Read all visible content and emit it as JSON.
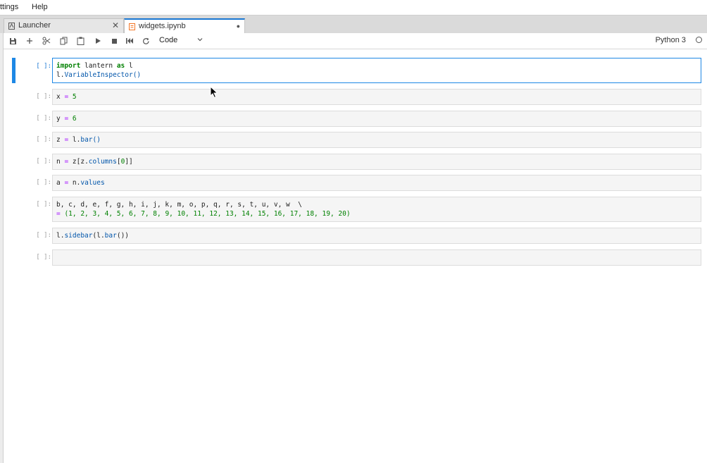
{
  "menubar": {
    "items": [
      "ttings",
      "Help"
    ]
  },
  "tabs": [
    {
      "label": "Launcher",
      "icon": "launcher-icon",
      "right": "✕",
      "active": false
    },
    {
      "label": "widgets.ipynb",
      "icon": "notebook-icon",
      "right": "●",
      "active": true
    }
  ],
  "toolbar": {
    "buttons": [
      "save-icon",
      "add-cell-icon",
      "cut-icon",
      "copy-icon",
      "paste-icon",
      "run-icon",
      "stop-icon",
      "restart-run-all-icon",
      "restart-icon"
    ],
    "cell_type": "Code",
    "kernel_name": "Python 3"
  },
  "cells": [
    {
      "prompt": "[ ]:",
      "selected": true
    },
    {
      "prompt": "[ ]:"
    },
    {
      "prompt": "[ ]:"
    },
    {
      "prompt": "[ ]:"
    },
    {
      "prompt": "[ ]:"
    },
    {
      "prompt": "[ ]:"
    },
    {
      "prompt": "[ ]:"
    },
    {
      "prompt": "[ ]:"
    },
    {
      "prompt": "[ ]:"
    }
  ],
  "code": {
    "c1_import": "import",
    "c1_module": " lantern ",
    "c1_as": "as",
    "c1_alias": " l",
    "c1_line2_obj": "l.",
    "c1_line2_fn": "VariableInspector",
    "c1_line2_paren": "()",
    "c2_var": "x ",
    "c2_eq": "=",
    "c2_val": " 5",
    "c3_var": "y ",
    "c3_eq": "=",
    "c3_val": " 6",
    "c4_var": "z ",
    "c4_eq": "=",
    "c4_obj": " l.",
    "c4_fn": "bar",
    "c4_paren": "()",
    "c5_var": "n ",
    "c5_eq": "=",
    "c5_a": " z[z.",
    "c5_attr": "columns",
    "c5_b": "[",
    "c5_idx": "0",
    "c5_c": "]]",
    "c6_var": "a ",
    "c6_eq": "=",
    "c6_obj": " n.",
    "c6_attr": "values",
    "c7_line1": "b, c, d, e, f, g, h, i, j, k, m, o, p, q, r, s, t, u, v, w  \\",
    "c7_eq": "=",
    "c7_line2": " (1, 2, 3, 4, 5, 6, 7, 8, 9, 10, 11, 12, 13, 14, 15, 16, 17, 18, 19, 20)",
    "c8_obj": "l.",
    "c8_fn": "sidebar",
    "c8_mid": "(l.",
    "c8_fn2": "bar",
    "c8_end": "())"
  },
  "colors": {
    "accent": "#1e88e5",
    "keyword": "#008000",
    "operator": "#aa22ff",
    "function": "#0055aa"
  }
}
